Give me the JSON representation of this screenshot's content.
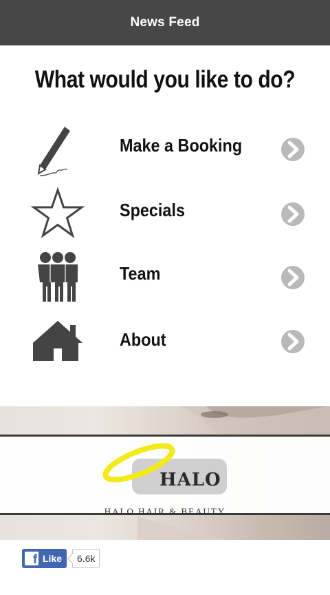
{
  "header": {
    "title": "News Feed"
  },
  "question": "What would you like to do?",
  "menu": [
    {
      "label": "Make a Booking",
      "icon": "pen-icon"
    },
    {
      "label": "Specials",
      "icon": "star-icon"
    },
    {
      "label": "Team",
      "icon": "team-icon"
    },
    {
      "label": "About",
      "icon": "home-icon"
    }
  ],
  "banner": {
    "logo_text": "HALO",
    "subtitle": "HALO HAIR & BEAUTY",
    "halo_color": "#f2ea1c"
  },
  "facebook": {
    "like_label": "Like",
    "count": "6.6k",
    "brand_color": "#4267b2"
  },
  "colors": {
    "header_bg": "#474747",
    "icon_color": "#444444",
    "chevron_color": "#b9b9b9"
  }
}
